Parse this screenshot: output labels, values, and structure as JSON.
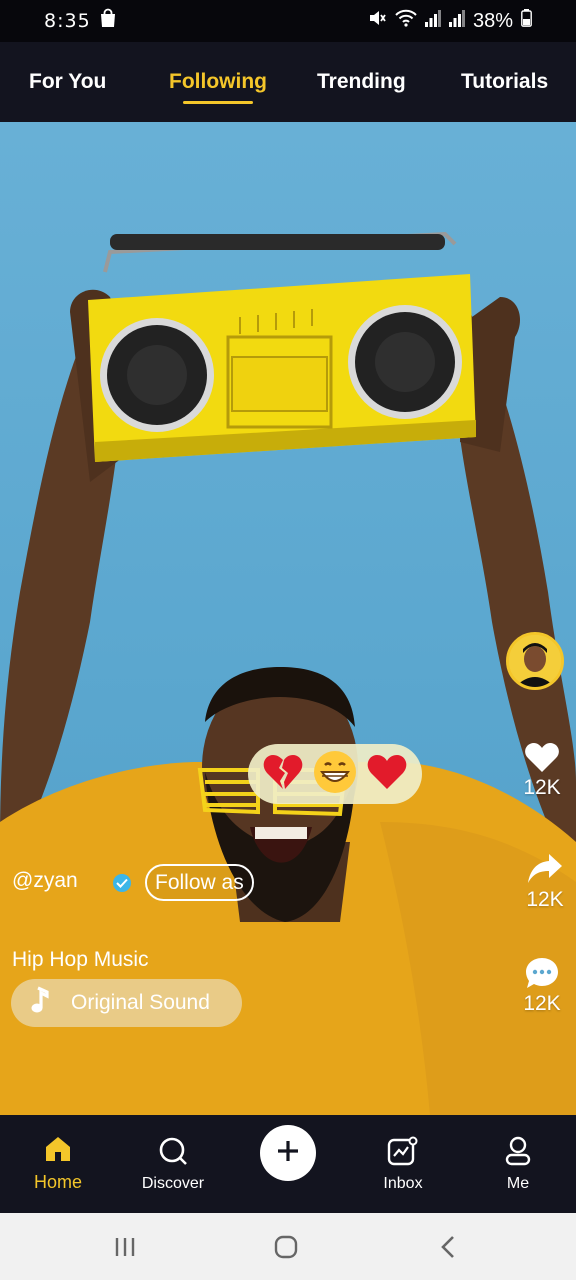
{
  "status_bar": {
    "time": "8:35",
    "battery": "38%",
    "icons": [
      "shopping-bag-icon",
      "mute-icon",
      "wifi-icon",
      "signal-icon",
      "signal-icon",
      "battery-icon"
    ]
  },
  "top_tabs": [
    {
      "label": "For You",
      "active": false
    },
    {
      "label": "Following",
      "active": true
    },
    {
      "label": "Trending",
      "active": false
    },
    {
      "label": "Tutorials",
      "active": false
    }
  ],
  "video": {
    "reactions": [
      "broken-heart-icon",
      "grinning-face-icon",
      "red-heart-icon"
    ],
    "rail": {
      "likes": "12K",
      "shares": "12K",
      "comments": "12K"
    },
    "post": {
      "username": "@zyan",
      "follow_label": "Follow as",
      "title": "Hip Hop Music",
      "sound": "Original Sound"
    }
  },
  "bottom_nav": [
    {
      "label": "Home",
      "icon": "home-icon",
      "active": true
    },
    {
      "label": "Discover",
      "icon": "search-icon",
      "active": false
    },
    {
      "label": "",
      "icon": "plus-icon",
      "active": false
    },
    {
      "label": "Inbox",
      "icon": "inbox-icon",
      "active": false
    },
    {
      "label": "Me",
      "icon": "profile-icon",
      "active": false
    }
  ],
  "colors": {
    "accent": "#f4c62a",
    "bar_bg": "#13141f",
    "video_bg": "#5ba7cf"
  }
}
